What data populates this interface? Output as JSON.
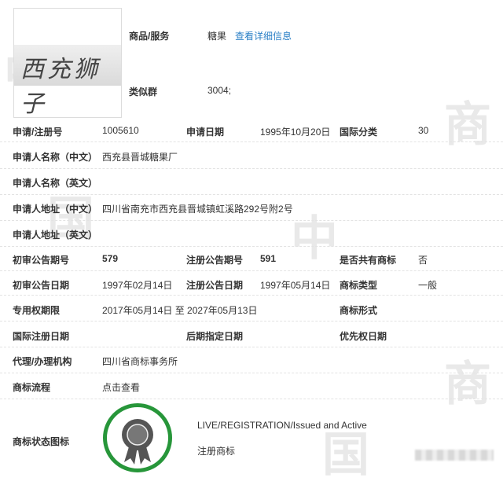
{
  "watermark_char_1": "中",
  "watermark_char_2": "国",
  "watermark_char_3": "商",
  "logo_text": "西充狮子",
  "goods_label": "商品/服务",
  "goods_value": "糖果",
  "goods_link": "查看详细信息",
  "similar_group_label": "类似群",
  "similar_group_value": "3004;",
  "reg_no_label": "申请/注册号",
  "reg_no": "1005610",
  "apply_date_label": "申请日期",
  "apply_date": "1995年10月20日",
  "intl_class_label": "国际分类",
  "intl_class": "30",
  "applicant_cn_label": "申请人名称（中文）",
  "applicant_cn": "西充县晋城糖果厂",
  "applicant_en_label": "申请人名称（英文）",
  "applicant_en": "",
  "address_cn_label": "申请人地址（中文）",
  "address_cn": "四川省南充市西充县晋城镇虹溪路292号附2号",
  "address_en_label": "申请人地址（英文）",
  "address_en": "",
  "prelim_issue_label": "初审公告期号",
  "prelim_issue": "579",
  "reg_issue_label": "注册公告期号",
  "reg_issue": "591",
  "shared_label": "是否共有商标",
  "shared": "否",
  "prelim_date_label": "初审公告日期",
  "prelim_date": "1997年02月14日",
  "reg_date_label": "注册公告日期",
  "reg_date": "1997年05月14日",
  "type_label": "商标类型",
  "type": "一般",
  "exclusive_label": "专用权期限",
  "exclusive": "2017年05月14日 至 2027年05月13日",
  "form_label": "商标形式",
  "form": "",
  "intl_reg_date_label": "国际注册日期",
  "later_date_label": "后期指定日期",
  "priority_date_label": "优先权日期",
  "agent_label": "代理/办理机构",
  "agent": "四川省商标事务所",
  "flow_label": "商标流程",
  "flow_link": "点击查看",
  "status_icon_label": "商标状态图标",
  "status_en": "LIVE/REGISTRATION/Issued and Active",
  "status_cn": "注册商标",
  "colors": {
    "link": "#2a7fc6",
    "badge_ring": "#27963a",
    "medal": "#555555"
  },
  "icons": {
    "status": "award-medal-icon"
  }
}
